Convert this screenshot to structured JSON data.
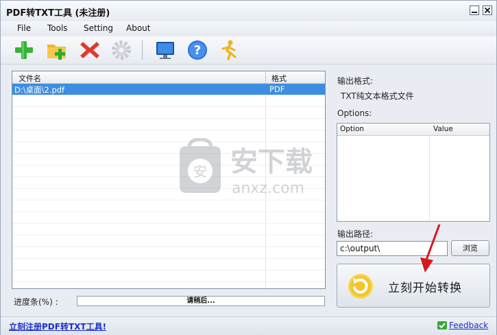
{
  "window": {
    "title": "PDF转TXT工具 (未注册)"
  },
  "menu": {
    "items": [
      "File",
      "Tools",
      "Setting",
      "About"
    ]
  },
  "toolbar": {
    "icons": [
      "add-icon",
      "add-folder-icon",
      "delete-icon",
      "settings-icon",
      "monitor-icon",
      "help-icon",
      "runner-icon"
    ]
  },
  "file_list": {
    "columns": [
      "文件名",
      "格式"
    ],
    "rows": [
      {
        "name": "D:\\桌面\\2.pdf",
        "format": "PDF"
      }
    ]
  },
  "output": {
    "format_label": "输出格式:",
    "format_value": "TXT纯文本格式文件",
    "options_label": "Options:",
    "options_columns": [
      "Option",
      "Value"
    ],
    "path_label": "输出路径:",
    "path_value": "c:\\output\\",
    "browse_label": "浏览",
    "convert_label": "立刻开始转换"
  },
  "progress": {
    "label": "进度条(%) :",
    "text": "请稍后...",
    "percent": 0
  },
  "status": {
    "register_link": "立刻注册PDF转TXT工具!",
    "feedback_link": "Feedback"
  },
  "watermark": {
    "cn": "安下载",
    "en": "anxz.com",
    "badge": "安"
  },
  "colors": {
    "selection": "#3d8ee0",
    "link": "#1a2fc8"
  }
}
